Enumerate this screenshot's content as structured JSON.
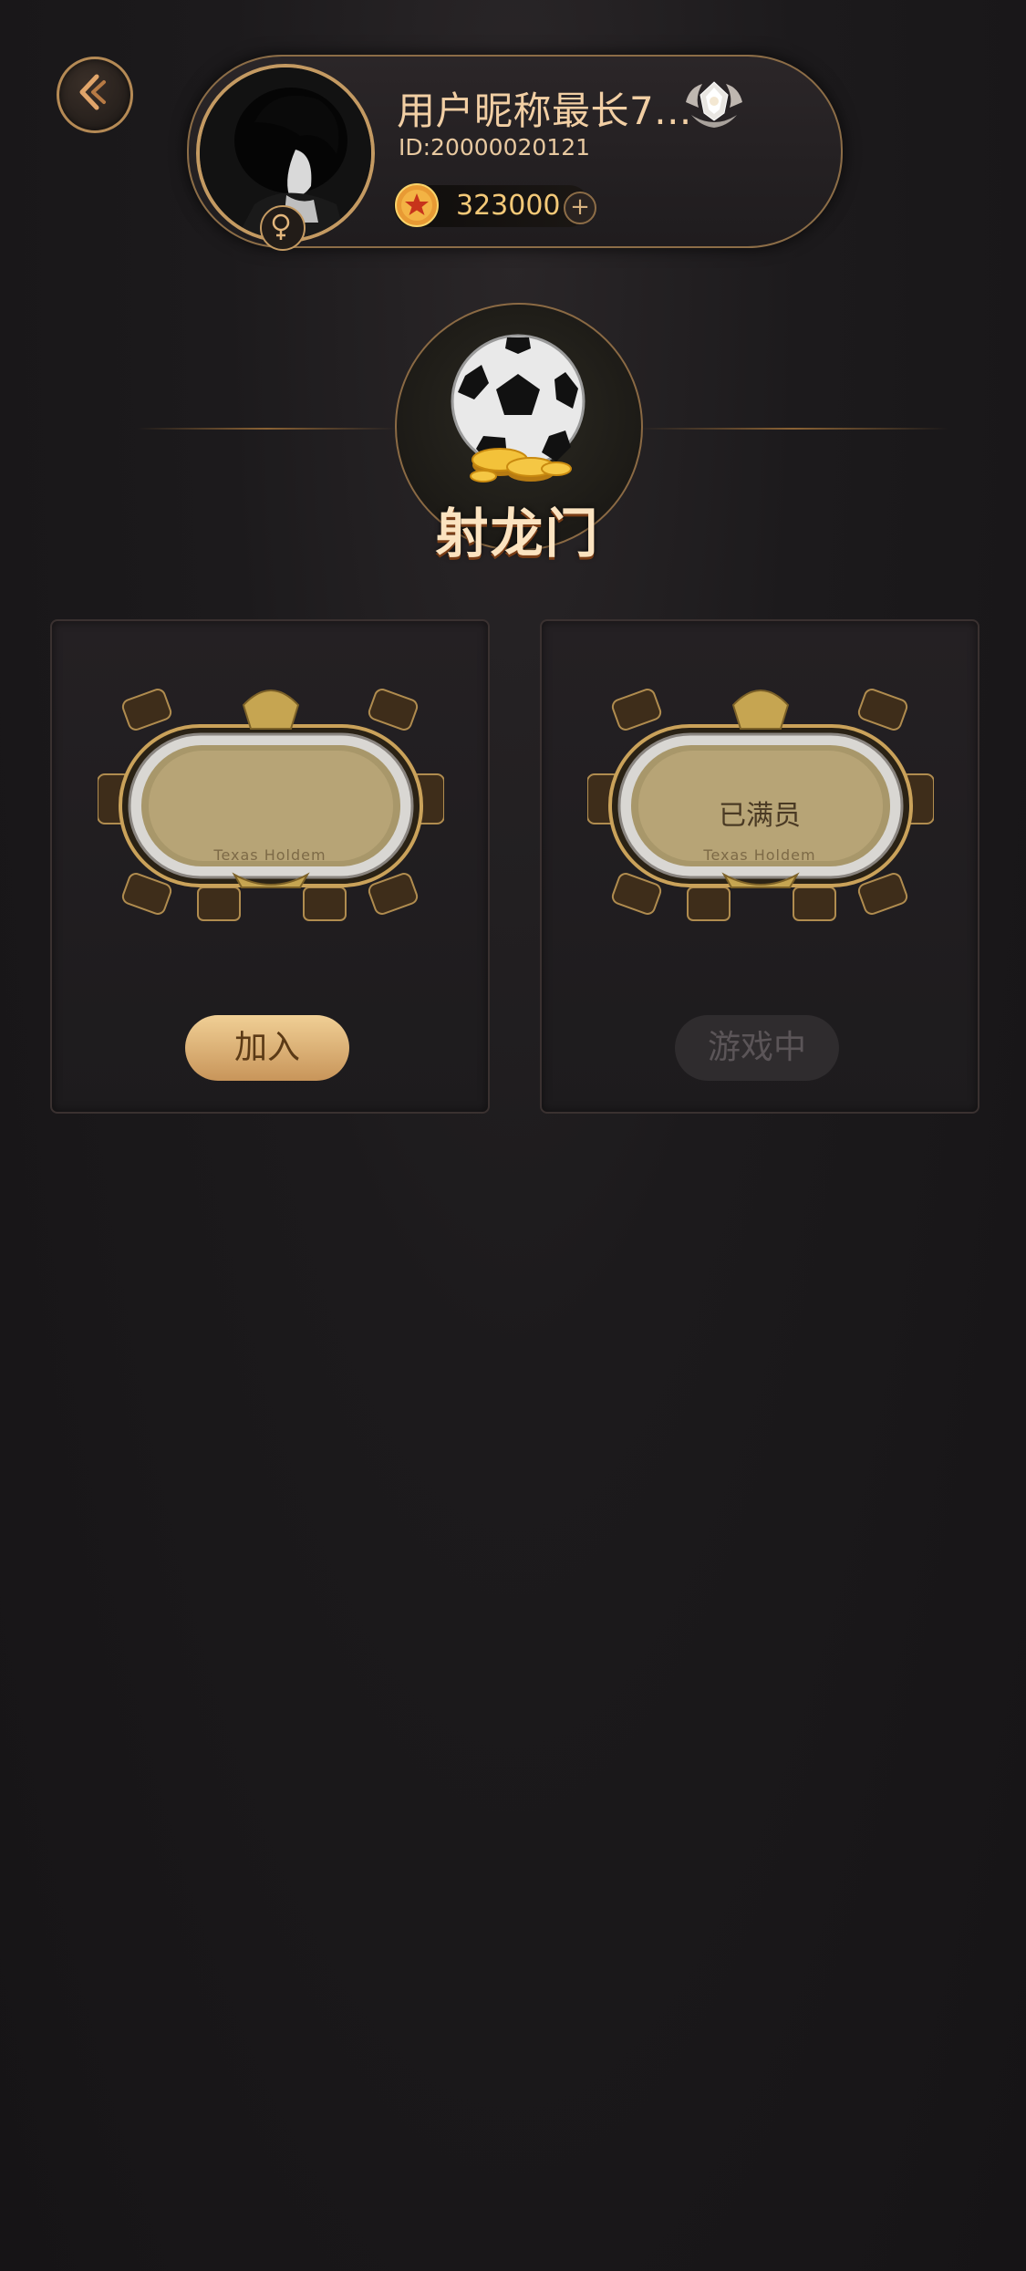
{
  "header": {
    "back_icon": "chevron-left-icon",
    "nickname": "用户昵称最长7...",
    "user_id": "ID:20000020121",
    "gender_icon": "female-icon",
    "rank_icon": "diamond-rank-badge-icon",
    "coins": {
      "icon": "coin-star-icon",
      "amount": "323000",
      "add_icon": "plus-icon",
      "add_label": "+"
    }
  },
  "game": {
    "title": "射龙门",
    "logo_icon": "soccer-ball-with-coins-icon"
  },
  "rooms": [
    {
      "table_status": "",
      "table_brand": "Texas Holdem",
      "button_label": "加入",
      "button_state": "enabled"
    },
    {
      "table_status": "已满员",
      "table_brand": "Texas Holdem",
      "button_label": "游戏中",
      "button_state": "disabled"
    }
  ],
  "colors": {
    "accent_gold": "#c49a62",
    "coin_text": "#f4c978",
    "title_text": "#fbe3c0",
    "background": "#1c1a1c"
  }
}
